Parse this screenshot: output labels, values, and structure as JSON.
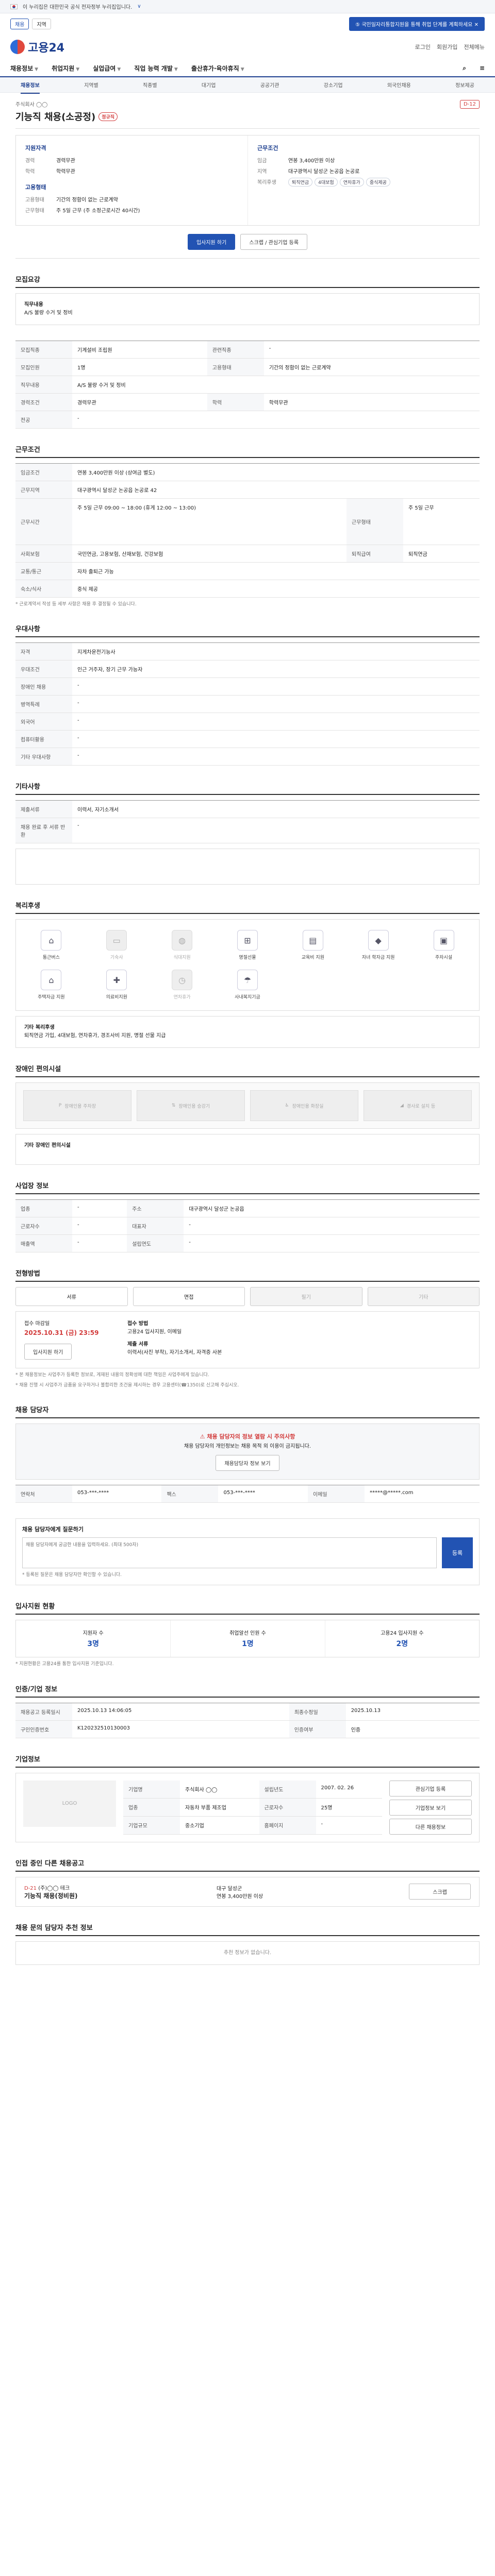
{
  "banner": {
    "text": "이 누리집은 대한민국 공식 전자정부 누리집입니다.",
    "toggle": "∨"
  },
  "topstrip": {
    "region_label": "채용",
    "region_value": "지역",
    "notice": "⑤ 국민일자리통합지원을 통해 취업 단계를 계획하세요 ✕"
  },
  "header": {
    "logo": "고용24",
    "links": [
      "로그인",
      "회원가입",
      "전체메뉴"
    ]
  },
  "gnb": [
    "채용정보",
    "취업지원",
    "실업급여",
    "직업 능력 개발",
    "출산휴가·육아휴직"
  ],
  "subnav": [
    "채용정보",
    "지역별",
    "직종별",
    "대기업",
    "공공기관",
    "강소기업",
    "외국인채용",
    "정보제공"
  ],
  "job": {
    "company": "주식회사 ◯◯",
    "title": "기능직 채용(소공정)",
    "badge": "정규직",
    "dday": "D-12",
    "qualifications_title": "지원자격",
    "qualifications": [
      {
        "k": "경력",
        "v": "경력무관"
      },
      {
        "k": "학력",
        "v": "학력무관"
      }
    ],
    "conditions_title": "근무조건",
    "conditions": [
      {
        "k": "임금",
        "v": "연봉 3,400만원 이상"
      },
      {
        "k": "지역",
        "v": "대구광역시 달성군 논공읍 논공로"
      }
    ],
    "conditions_chips_label": "복리후생",
    "conditions_chips": [
      "퇴직연금",
      "4대보험",
      "연차휴가",
      "중식제공"
    ],
    "form_title": "고용형태",
    "form": [
      {
        "k": "고용형태",
        "v": "기간의 정함이 없는 근로계약"
      },
      {
        "k": "근무형태",
        "v": "주 5일 근무 (주 소정근로시간 40시간)"
      }
    ]
  },
  "actions": {
    "apply": "입사지원 하기",
    "scrap": "스크랩 / 관심기업 등록"
  },
  "sections": {
    "duty": {
      "title": "모집요강",
      "subtitle": "직무내용",
      "text": "A/S 불량 수거 및 정비"
    },
    "recruit_table_title": "모집요강",
    "conditions_title": "근무조건",
    "conditions_note": "* 근로계약서 작성 등 세부 사항은 채용 후 결정될 수 있습니다.",
    "preferred_title": "우대사항",
    "apply_doc_title": "기타사항",
    "welfare_title": "복리후생",
    "welfare_other": "기타 복리후생",
    "welfare_other_text": "퇴직연금 가입, 4대보험, 연차휴가, 경조사비 지원, 명절 선물 지급",
    "disability_title": "장애인 편의시설",
    "disability_other": "기타 장애인 편의시설",
    "workplace_title": "사업장 정보",
    "process_title": "전형방법",
    "contact_title": "채용 담당자",
    "qna_title": "채용 담당자에게 질문하기",
    "stats_title": "입사지원 현황",
    "org_title": "인증/기업 정보",
    "company_title": "기업정보",
    "related_title": "인접 중인 다른 채용공고",
    "recommend_title": "채용 문의 담당자 추천 정보"
  },
  "recruit_table": [
    {
      "k": "모집직종",
      "v": "기계설비 조립원"
    },
    {
      "k": "관련직종",
      "v": "-"
    },
    {
      "k": "모집인원",
      "v": "1명"
    },
    {
      "k": "고용형태",
      "v": "기간의 정함이 없는 근로계약"
    },
    {
      "k": "직무내용",
      "v": "A/S 불량 수거 및 정비"
    },
    {
      "k": "경력조건",
      "v": "경력무관"
    },
    {
      "k": "학력",
      "v": "학력무관"
    },
    {
      "k": "전공",
      "v": "-"
    }
  ],
  "conditions_table": [
    {
      "k": "임금조건",
      "v": "연봉 3,400만원 이상 (상여금 별도)"
    },
    {
      "k": "근무지역",
      "v": "대구광역시 달성군 논공읍 논공로 42"
    },
    {
      "k": "근무시간",
      "v": "주 5일 근무 09:00 ~ 18:00 (휴게 12:00 ~ 13:00)"
    },
    {
      "k": "근무형태",
      "v": "주 5일 근무"
    },
    {
      "k": "사회보험",
      "v": "국민연금, 고용보험, 산재보험, 건강보험"
    },
    {
      "k": "퇴직급여",
      "v": "퇴직연금"
    },
    {
      "k": "교통/통근",
      "v": "자차 출퇴근 가능"
    },
    {
      "k": "숙소/식사",
      "v": "중식 제공"
    }
  ],
  "preferred_table": [
    {
      "k": "자격",
      "v": "지게차운전기능사"
    },
    {
      "k": "우대조건",
      "v": "인근 거주자, 장기 근무 가능자"
    },
    {
      "k": "장애인 채용",
      "v": "-"
    },
    {
      "k": "병역특례",
      "v": "-"
    },
    {
      "k": "외국어",
      "v": "-"
    },
    {
      "k": "컴퓨터활용",
      "v": "-"
    },
    {
      "k": "기타 우대사항",
      "v": "-"
    }
  ],
  "apply_doc_table": [
    {
      "k": "제출서류",
      "v": "이력서, 자기소개서"
    },
    {
      "k": "채용 완료 후 서류 반환",
      "v": "-"
    }
  ],
  "welfare_items": [
    {
      "icon": "house-icon",
      "glyph": "⌂",
      "label": "통근버스",
      "on": true
    },
    {
      "icon": "bus-icon",
      "glyph": "▭",
      "label": "기숙사",
      "on": false
    },
    {
      "icon": "meal-icon",
      "glyph": "◍",
      "label": "식대지원",
      "on": false
    },
    {
      "icon": "gift-icon",
      "glyph": "⊞",
      "label": "명절선물",
      "on": true
    },
    {
      "icon": "book-icon",
      "glyph": "▤",
      "label": "교육비 지원",
      "on": true
    },
    {
      "icon": "grad-icon",
      "glyph": "◆",
      "label": "자녀 학자금 지원",
      "on": true
    },
    {
      "icon": "car-icon",
      "glyph": "▣",
      "label": "주차시설",
      "on": true
    },
    {
      "icon": "home-icon",
      "glyph": "⌂",
      "label": "주택자금 지원",
      "on": true
    },
    {
      "icon": "medical-icon",
      "glyph": "✚",
      "label": "의료비지원",
      "on": true
    },
    {
      "icon": "leave-icon",
      "glyph": "◷",
      "label": "연차휴가",
      "on": false
    },
    {
      "icon": "insurance-icon",
      "glyph": "☂",
      "label": "사내복지기금",
      "on": true
    }
  ],
  "disability_items": [
    "장애인용 주차장",
    "장애인용 승강기",
    "장애인용 화장실",
    "경사로 설치 등"
  ],
  "workplace_table": [
    {
      "k": "업종",
      "v": "-"
    },
    {
      "k": "주소",
      "v": "대구광역시 달성군 논공읍"
    },
    {
      "k": "근로자수",
      "v": "-"
    },
    {
      "k": "대표자",
      "v": "-"
    },
    {
      "k": "매출액",
      "v": "-"
    },
    {
      "k": "설립연도",
      "v": "-"
    }
  ],
  "process_steps": [
    {
      "label": "서류",
      "on": true
    },
    {
      "label": "면접",
      "on": true
    },
    {
      "label": "필기",
      "on": false
    },
    {
      "label": "기타",
      "on": false
    }
  ],
  "apply_info": {
    "deadline_label": "접수 마감일",
    "deadline": "2025.10.31 (금) 23:59",
    "method_label": "접수 방법",
    "method": "고용24 입사지원, 이메일",
    "docs_label": "제출 서류",
    "docs": "이력서(사진 부착), 자기소개서, 자격증 사본",
    "btn": "입사지원 하기"
  },
  "apply_notes": [
    "* 본 채용정보는 사업주가 등록한 정보로, 게재된 내용의 정확성에 대한 책임은 사업주에게 있습니다.",
    "* 채용 진행 시 사업주가 금품을 요구하거나 불합리한 조건을 제시하는 경우 고용센터(☎1350)로 신고해 주십시오."
  ],
  "contact": {
    "warn_title": "채용 담당자의 정보 열람 시 주의사항",
    "warn_text": "채용 담당자의 개인정보는 채용 목적 외 이용이 금지됩니다.",
    "btn": "채용담당자 정보 보기",
    "rows": [
      {
        "k": "연락처",
        "v": "053-***-****"
      },
      {
        "k": "팩스",
        "v": "053-***-****"
      },
      {
        "k": "이메일",
        "v": "*****@*****.com"
      }
    ]
  },
  "qna": {
    "placeholder": "채용 담당자에게 궁금한 내용을 입력하세요. (최대 500자)",
    "send": "등록",
    "note": "* 등록된 질문은 채용 담당자만 확인할 수 있습니다."
  },
  "stats": [
    {
      "label": "지원자 수",
      "value": "3명"
    },
    {
      "label": "취업알선 인원 수",
      "value": "1명"
    },
    {
      "label": "고용24 입사지원 수",
      "value": "2명"
    }
  ],
  "stats_note": "* 지원현황은 고용24를 통한 입사지원 기준입니다.",
  "org_table": [
    {
      "k": "채용공고 등록일시",
      "v": "2025.10.13 14:06:05"
    },
    {
      "k": "최종수정일",
      "v": "2025.10.13"
    },
    {
      "k": "구인인증번호",
      "v": "K120232510130003"
    },
    {
      "k": "인증여부",
      "v": "인증"
    }
  ],
  "company": {
    "logo_alt": "LOGO",
    "rows": [
      {
        "k": "기업명",
        "v": "주식회사 ◯◯"
      },
      {
        "k": "업종",
        "v": "자동차 부품 제조업"
      },
      {
        "k": "기업규모",
        "v": "중소기업"
      },
      {
        "k": "설립년도",
        "v": "2007. 02. 26"
      },
      {
        "k": "근로자수",
        "v": "25명"
      },
      {
        "k": "홈페이지",
        "v": "-"
      }
    ],
    "btns": [
      "관심기업 등록",
      "기업정보 보기",
      "다른 채용정보"
    ]
  },
  "related": {
    "dday": "D-21",
    "company": "(주)◯◯ 테크",
    "title": "기능직 채용(정비원)",
    "region": "대구 달성군",
    "salary": "연봉 3,400만원 이상",
    "btn": "스크랩"
  },
  "recommend": {
    "text": "추천 정보가 없습니다."
  }
}
